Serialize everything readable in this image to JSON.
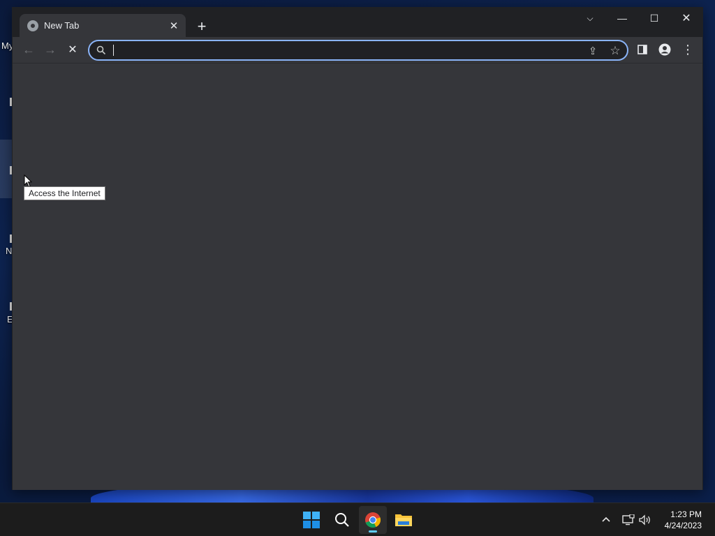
{
  "desktop": {
    "labels": [
      "My",
      "N",
      "E"
    ]
  },
  "browser": {
    "tab": {
      "title": "New Tab",
      "close_glyph": "✕"
    },
    "new_tab_glyph": "+",
    "window_controls": {
      "tab_search_glyph": "⌵",
      "minimize_glyph": "—",
      "maximize_glyph": "☐",
      "close_glyph": "✕"
    },
    "toolbar": {
      "back_glyph": "←",
      "forward_glyph": "→",
      "stop_glyph": "✕",
      "share_glyph": "⇪",
      "bookmark_glyph": "☆",
      "menu_glyph": "⋮"
    },
    "omnibox": {
      "value": "",
      "placeholder": ""
    }
  },
  "tooltip": {
    "text": "Access the Internet"
  },
  "taskbar": {
    "apps": [
      "start",
      "search",
      "chrome",
      "file-explorer"
    ],
    "active_app": "chrome",
    "tray": {
      "chevron_glyph": "^"
    },
    "clock": {
      "time": "1:23 PM",
      "date": "4/24/2023"
    }
  },
  "colors": {
    "accent": "#8ab4f8",
    "window_bg": "#35363a",
    "titlebar_bg": "#202124",
    "taskbar_bg": "#1c1c1c",
    "indicator": "#60cdff"
  }
}
